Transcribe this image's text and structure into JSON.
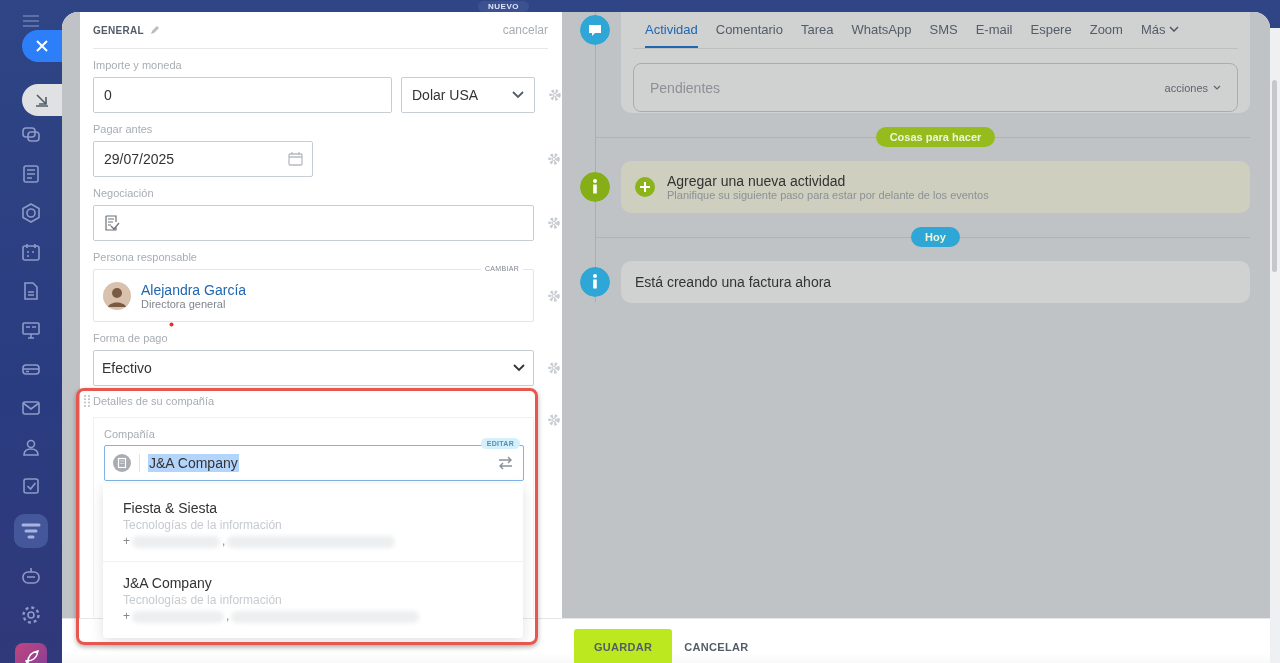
{
  "top_badge": "NUEVO",
  "sidebar": {
    "items": [
      {
        "kind": "chat",
        "selected": false
      },
      {
        "kind": "news",
        "selected": false
      },
      {
        "kind": "hexagon",
        "selected": false
      },
      {
        "kind": "calendar",
        "selected": false
      },
      {
        "kind": "document",
        "selected": false
      },
      {
        "kind": "board",
        "selected": false
      },
      {
        "kind": "drive",
        "selected": false
      },
      {
        "kind": "mail",
        "selected": false
      },
      {
        "kind": "users",
        "selected": false
      },
      {
        "kind": "check",
        "selected": false
      },
      {
        "kind": "filter",
        "selected": true
      },
      {
        "kind": "robot",
        "selected": false
      },
      {
        "kind": "gear",
        "selected": false
      },
      {
        "kind": "rocket",
        "selected": false
      }
    ]
  },
  "form": {
    "title": "GENERAL",
    "cancel": "cancelar",
    "fields": [
      {
        "kind": "amount",
        "label": "Importe y moneda",
        "value": "0",
        "currency": "Dolar USA"
      },
      {
        "kind": "date",
        "label": "Pagar antes",
        "value": "29/07/2025"
      },
      {
        "kind": "deal",
        "label": "Negociación"
      },
      {
        "kind": "person",
        "label": "Persona responsable",
        "action": "CAMBIAR",
        "name": "Alejandra García",
        "role": "Directora general"
      },
      {
        "kind": "select",
        "label": "Forma de pago",
        "required": true,
        "value": "Efectivo"
      }
    ],
    "company_section": {
      "title": "Detalles de su compañía",
      "field_label": "Compañía",
      "value": "J&A Company",
      "text_selected": true,
      "badge": "EDITAR",
      "options": [
        {
          "name": "Fiesta & Siesta",
          "industry": "Tecnologías de la información",
          "phone_prefix": "+",
          "separator": ","
        },
        {
          "name": "J&A Company",
          "industry": "Tecnologías de la información",
          "phone_prefix": "+",
          "separator": ","
        }
      ]
    }
  },
  "timeline": {
    "tabs": [
      {
        "label": "Actividad",
        "selected": true
      },
      {
        "label": "Comentario",
        "selected": false
      },
      {
        "label": "Tarea",
        "selected": false
      },
      {
        "label": "WhatsApp",
        "selected": false
      },
      {
        "label": "SMS",
        "selected": false
      },
      {
        "label": "E-mail",
        "selected": false
      },
      {
        "label": "Espere",
        "selected": false
      },
      {
        "label": "Zoom",
        "selected": false
      },
      {
        "label": "Más",
        "selected": false
      }
    ],
    "placeholder": "Pendientes",
    "actions": "acciones",
    "entries": [
      {
        "kind": "divider",
        "label": "Cosas para hacer",
        "color": "#95bc1c"
      },
      {
        "kind": "add",
        "title": "Agregar una nueva actividad",
        "subtitle": "Planifique su siguiente paso para estar por delante de los eventos"
      },
      {
        "kind": "divider",
        "label": "Hoy",
        "color": "#2ea6d6"
      },
      {
        "kind": "info",
        "title": "Está creando una factura ahora"
      }
    ]
  },
  "footer": {
    "buttons": [
      {
        "label": "GUARDAR",
        "kind": "primary"
      },
      {
        "label": "CANCELAR",
        "kind": "link"
      }
    ]
  }
}
